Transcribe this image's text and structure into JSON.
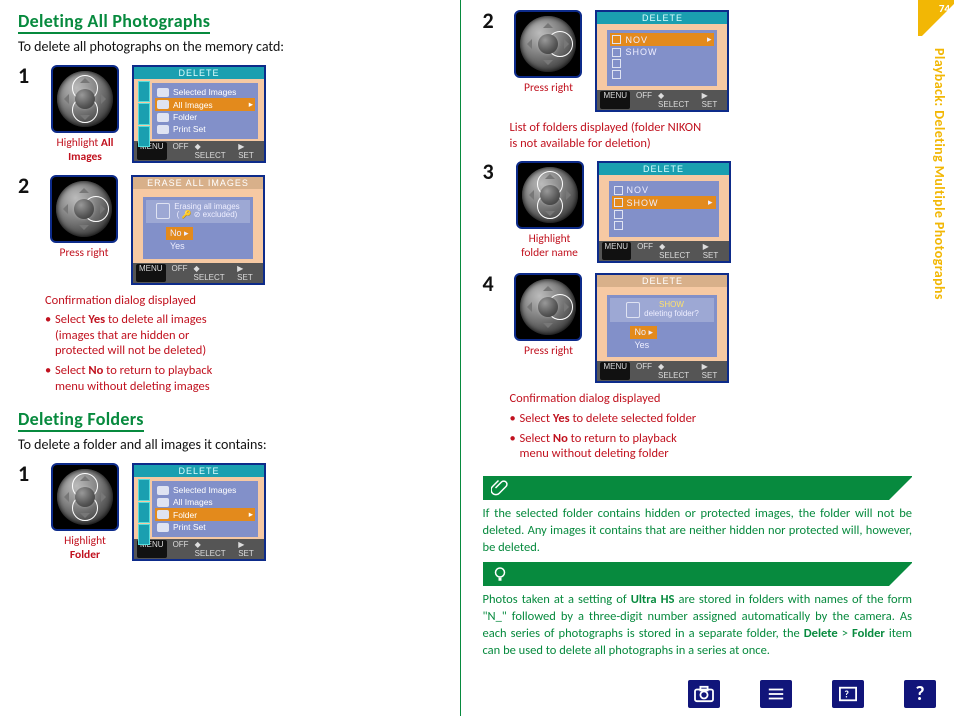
{
  "page_number": "74",
  "side_title": "Playback: Deleting Multiple Photographs",
  "left": {
    "section1_heading": "Deleting All Photographs",
    "section1_lead": "To delete all photographs on the memory catd:",
    "step1_caption_a": "Highlight ",
    "step1_caption_b": "All Images",
    "lcd1_title": "DELETE",
    "menu_items": {
      "m1": "Selected Images",
      "m2": "All Images",
      "m3": "Folder",
      "m4": "Print Set"
    },
    "status": {
      "menu": "MENU",
      "off": "OFF",
      "select": "◆ SELECT",
      "set": "▶ SET"
    },
    "step2_caption": "Press right",
    "lcd2_title": "ERASE ALL IMAGES",
    "erase_msg_a": "Erasing all images",
    "erase_msg_b": "( 🔑 ⊘ excluded)",
    "opt_no": "No",
    "opt_yes": "Yes",
    "note2_head": "Confirmation dialog displayed",
    "note2_li1a": "Select ",
    "note2_li1b": "Yes",
    "note2_li1c": " to delete all images (images that are hidden or protected will not be deleted)",
    "note2_li2a": "Select ",
    "note2_li2b": "No",
    "note2_li2c": " to return to playback menu without deleting images",
    "section2_heading": "Deleting Folders",
    "section2_lead": "To delete a folder and all images it contains:",
    "stepF1_caption_a": "Highlight",
    "stepF1_caption_b": "Folder"
  },
  "right": {
    "step2_caption": "Press right",
    "lcd_folders_title": "DELETE",
    "folder_nov": "NOV",
    "folder_show": "SHOW",
    "note2": "List of folders displayed (folder NIKON is not available for deletion)",
    "step3_caption_a": "Highlight",
    "step3_caption_b": "folder name",
    "step4_caption": "Press right",
    "lcd4_msg_a": "SHOW",
    "lcd4_msg_b": "deleting folder?",
    "note4_head": "Confirmation dialog displayed",
    "note4_li1a": "Select ",
    "note4_li1b": "Yes",
    "note4_li1c": " to delete selected folder",
    "note4_li2a": "Select ",
    "note4_li2b": "No",
    "note4_li2c": " to return to playback menu without deleting folder",
    "greennote1": "If the selected folder contains hidden or protected images, the folder will not be deleted.  Any images it contains that are neither hidden nor protected will, however, be deleted.",
    "greennote2_a": "Photos taken at a setting of ",
    "greennote2_b": "Ultra HS",
    "greennote2_c": " are stored in folders with names of the form \"N_\" followed by a three-digit number assigned automatically by the camera.  As each series of photographs is stored in a separate folder, the ",
    "greennote2_d": "Delete",
    "greennote2_e": " > ",
    "greennote2_f": "Folder",
    "greennote2_g": " item can be used to delete all photographs in a series at once."
  }
}
